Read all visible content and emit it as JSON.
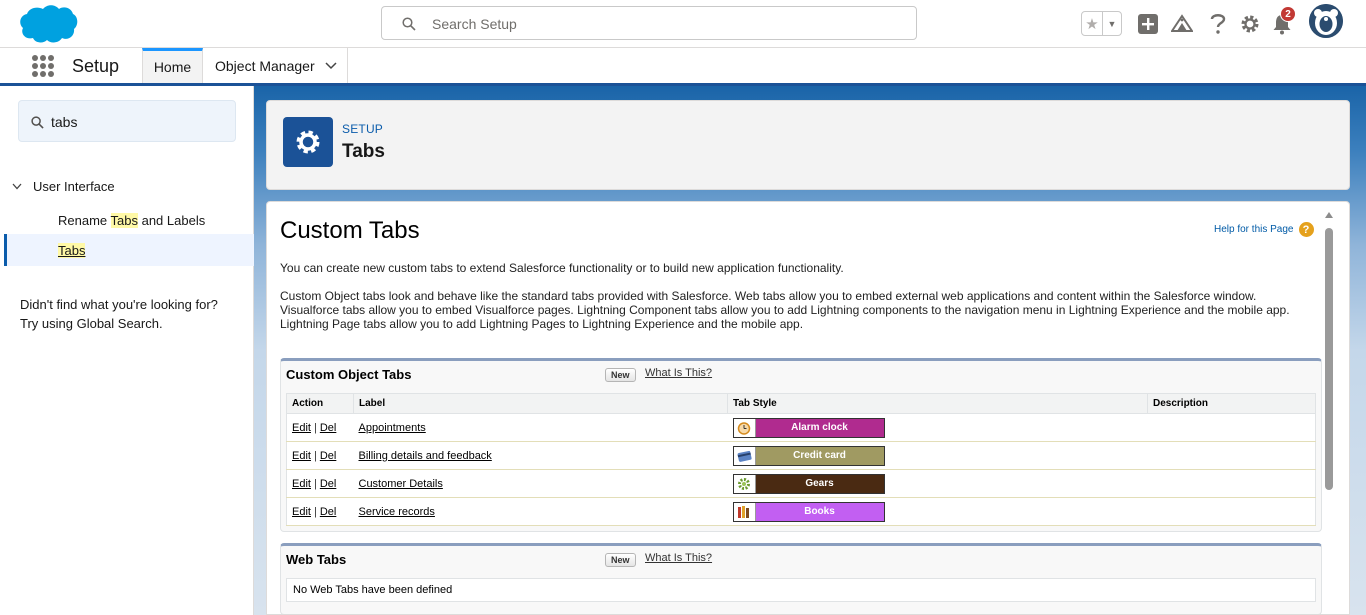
{
  "header": {
    "search_placeholder": "Search Setup",
    "notification_count": "2",
    "icons": [
      "favorites-star-icon",
      "favorites-dropdown-icon",
      "global-actions-add-icon",
      "trailhead-guidance-icon",
      "help-icon",
      "setup-gear-icon",
      "notifications-bell-icon",
      "user-avatar"
    ]
  },
  "context_bar": {
    "app_name": "Setup",
    "tabs": [
      {
        "label": "Home",
        "active": true
      },
      {
        "label": "Object Manager",
        "active": false
      }
    ]
  },
  "sidebar": {
    "search_value": "tabs",
    "tree_parent": "User Interface",
    "items": [
      {
        "before": "Rename ",
        "highlight": "Tabs",
        "after": " and Labels",
        "selected": false
      },
      {
        "before": "",
        "highlight": "Tabs",
        "after": "",
        "selected": true
      }
    ],
    "help_line1": "Didn't find what you're looking for?",
    "help_line2": "Try using Global Search."
  },
  "page_header": {
    "label": "SETUP",
    "title": "Tabs"
  },
  "content": {
    "title": "Custom Tabs",
    "help_link": "Help for this Page",
    "help_icon_glyph": "?",
    "para1": "You can create new custom tabs to extend Salesforce functionality or to build new application functionality.",
    "para2_line1": "Custom Object tabs look and behave like the standard tabs provided with Salesforce. Web tabs allow you to embed external web applications and content within the Salesforce window.",
    "para2_line2": "Visualforce tabs allow you to embed Visualforce pages. Lightning Component tabs allow you to add Lightning components to the navigation menu in Lightning Experience and the mobile app.",
    "para2_line3": "Lightning Page tabs allow you to add Lightning Pages to Lightning Experience and the mobile app.",
    "custom_object_tabs": {
      "heading": "Custom Object Tabs",
      "new_button": "New",
      "what_link": "What Is This?",
      "columns": [
        "Action",
        "Label",
        "Tab Style",
        "Description"
      ],
      "edit_label": "Edit",
      "del_label": "Del",
      "separator": "|",
      "rows": [
        {
          "label": "Appointments",
          "style_name": "Alarm clock",
          "style_color": "#b02b8f",
          "icon": "alarm-clock-icon"
        },
        {
          "label": "Billing details and feedback",
          "style_name": "Credit card",
          "style_color": "#a09a62",
          "icon": "credit-card-icon"
        },
        {
          "label": "Customer Details",
          "style_name": "Gears",
          "style_color": "#4a2a12",
          "icon": "gears-icon"
        },
        {
          "label": "Service records",
          "style_name": "Books",
          "style_color": "#c25ff2",
          "icon": "books-icon"
        }
      ]
    },
    "web_tabs": {
      "heading": "Web Tabs",
      "new_button": "New",
      "what_link": "What Is This?",
      "empty_text": "No Web Tabs have been defined"
    }
  },
  "colors": {
    "brand_blue": "#1b5297",
    "link_blue": "#015ba7",
    "salesforce_cloud": "#00a1e0",
    "notification_red": "#c23934"
  }
}
